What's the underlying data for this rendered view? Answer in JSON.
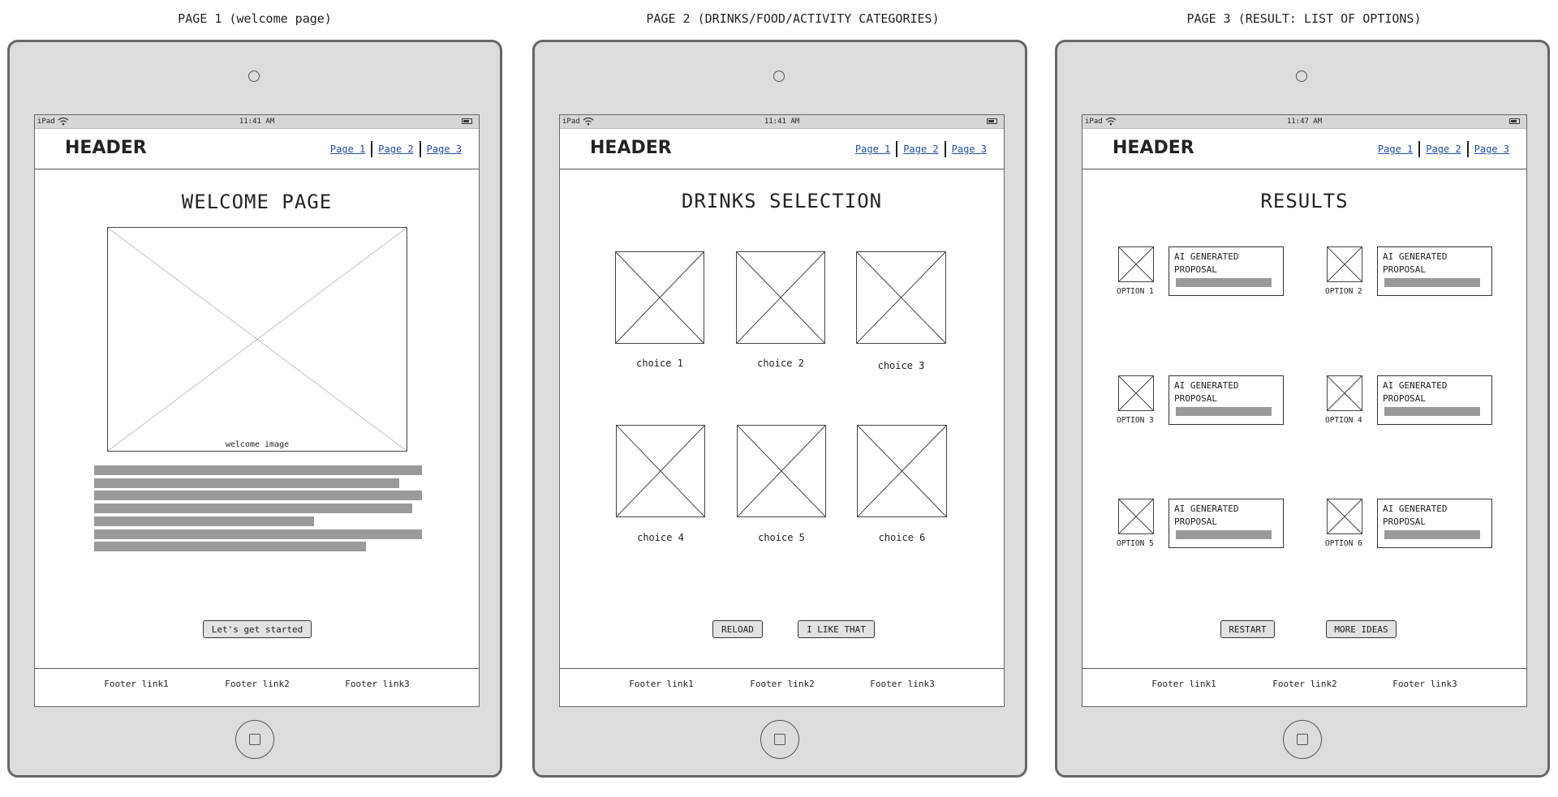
{
  "sections": [
    {
      "title": "PAGE 1 (welcome page)"
    },
    {
      "title": "PAGE 2 (DRINKS/FOOD/ACTIVITY CATEGORIES)"
    },
    {
      "title": "PAGE 3 (RESULT: LIST OF OPTIONS)"
    }
  ],
  "status": {
    "device": "iPad",
    "time_page1": "11:41 AM",
    "time_page2": "11:41 AM",
    "time_page3": "11:47 AM"
  },
  "nav": {
    "brand": "HEADER",
    "links": [
      "Page 1",
      "Page 2",
      "Page 3"
    ]
  },
  "page1": {
    "heading": "WELCOME PAGE",
    "image_caption": "welcome image",
    "text_lines": [
      1.0,
      0.93,
      1.0,
      0.97,
      0.67,
      1.0,
      0.83
    ],
    "button": "Let's get started"
  },
  "page2": {
    "heading": "DRINKS SELECTION",
    "choices": [
      "choice 1",
      "choice 2",
      "choice 3",
      "choice 4",
      "choice 5",
      "choice 6"
    ],
    "buttons": [
      "RELOAD",
      "I LIKE THAT"
    ]
  },
  "page3": {
    "heading": "RESULTS",
    "options": [
      "OPTION 1",
      "OPTION 2",
      "OPTION 3",
      "OPTION 4",
      "OPTION 5",
      "OPTION 6"
    ],
    "proposal_line1": "AI GENERATED",
    "proposal_line2": "PROPOSAL",
    "buttons": [
      "RESTART",
      "MORE IDEAS"
    ]
  },
  "footer": {
    "links": [
      "Footer link1",
      "Footer link2",
      "Footer link3"
    ]
  }
}
